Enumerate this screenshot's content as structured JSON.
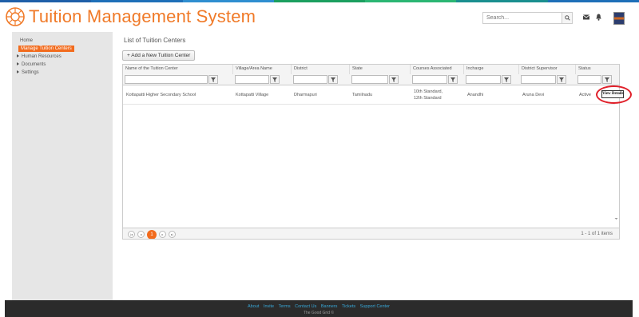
{
  "header": {
    "title": "Tuition Management System",
    "search_placeholder": "Search...",
    "stripe_colors": [
      "#1f5fa8",
      "#1e6fb8",
      "#2f8ed0",
      "#1b9f5f",
      "#2bb673",
      "#1a8f8f",
      "#1e6fb8"
    ]
  },
  "sidebar": {
    "items": [
      {
        "label": "Home",
        "active": false
      },
      {
        "label": "Manage Tuition  Centers",
        "active": true
      },
      {
        "label": "Human Resources",
        "expandable": true
      },
      {
        "label": "Documents",
        "expandable": true
      },
      {
        "label": "Settings",
        "expandable": true
      }
    ]
  },
  "main": {
    "page_title": "List of Tuition Centers",
    "add_button": "+ Add a New Tuition Center",
    "columns": [
      "Name of the Tuition Center",
      "Village/Area Name",
      "District",
      "State",
      "Courses Associated",
      "Incharge",
      "District Supervisor",
      "Status"
    ],
    "rows": [
      {
        "name": "Kottapatti Higher Secondary School",
        "village": "Kottapatti Village",
        "district": "Dharmapuri",
        "state": "Tamilnadu",
        "courses_1": "10th Standard,",
        "courses_2": "12th Standard",
        "incharge": "Anandhi",
        "supervisor": "Aruna Devi",
        "status": "Active"
      }
    ],
    "view_details": "View Details",
    "pager": {
      "current": "1",
      "info": "1 - 1 of 1 items"
    }
  },
  "footer": {
    "links": [
      "About",
      "Invite",
      "Terms",
      "Contact Us",
      "Banners",
      "Tickets",
      "Support Center"
    ],
    "copyright": "The Good Grid ©"
  },
  "colors": {
    "accent": "#f26b1d",
    "highlight_circle": "#e0202a",
    "footer_bg": "#2b2b2b",
    "link": "#39a8d8"
  }
}
